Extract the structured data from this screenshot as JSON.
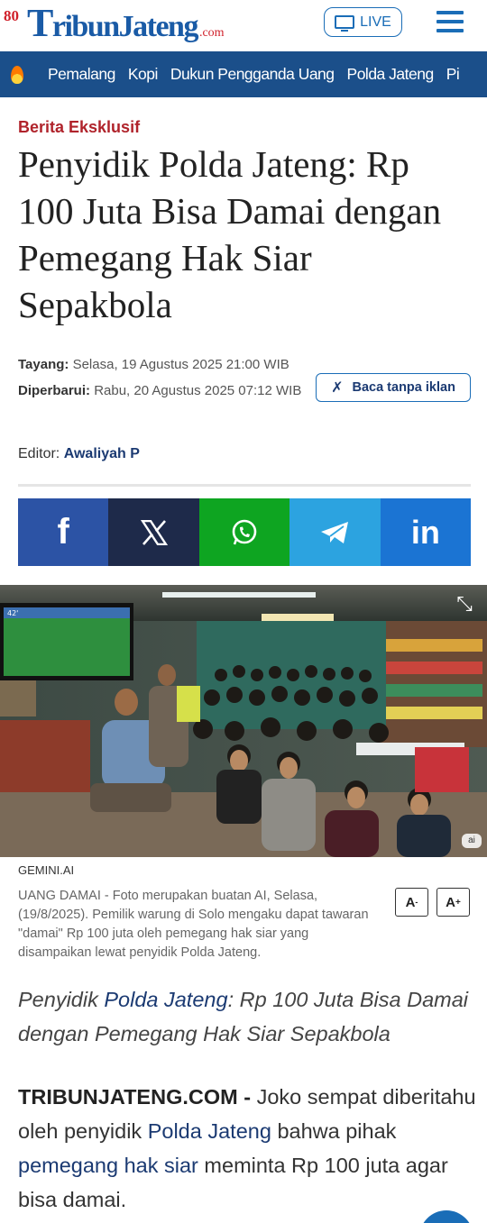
{
  "header": {
    "logo_anniv": "80",
    "logo_text_first": "T",
    "logo_text_rest": "ribunJateng",
    "logo_com": ".com",
    "live_label": "LIVE"
  },
  "nav": {
    "items": [
      {
        "label": "Pemalang"
      },
      {
        "label": "Kopi"
      },
      {
        "label": "Dukun Pengganda Uang"
      },
      {
        "label": "Polda Jateng"
      },
      {
        "label": "Pi"
      }
    ]
  },
  "article": {
    "category": "Berita Eksklusif",
    "title": "Penyidik Polda Jateng: Rp 100 Juta Bisa Damai dengan Pemegang Hak Siar Sepakbola",
    "tayang_label": "Tayang:",
    "tayang_value": "Selasa, 19 Agustus 2025 21:00 WIB",
    "diperbarui_label": "Diperbarui:",
    "diperbarui_value": "Rabu, 20 Agustus 2025 07:12 WIB",
    "adfree_label": "Baca tanpa iklan",
    "editor_label": "Editor:",
    "editor_name": "Awaliyah P"
  },
  "share": {
    "icons": [
      "facebook-icon",
      "x-icon",
      "whatsapp-icon",
      "telegram-icon",
      "linkedin-icon"
    ],
    "colors": [
      "#2c53a5",
      "#1e2a4a",
      "#0ea521",
      "#2ca3e0",
      "#1b74d3"
    ]
  },
  "photo": {
    "scoreboard": "42'",
    "ai_badge": "ai"
  },
  "media": {
    "credit": "GEMINI.AI",
    "caption": "UANG DAMAI - Foto merupakan buatan AI, Selasa, (19/8/2025). Pemilik warung di Solo mengaku dapat tawaran \"damai\" Rp 100 juta oleh pemegang hak siar yang disampaikan lewat penyidik Polda Jateng.",
    "font_minus": "A",
    "font_plus": "A"
  },
  "lead": {
    "part1": "Penyidik ",
    "link": "Polda Jateng",
    "part2": ": Rp 100 Juta Bisa Damai dengan Pemegang Hak Siar Sepakbola"
  },
  "body": {
    "dateline": "TRIBUNJATENG.COM -",
    "t1": " Joko sempat diberitahu oleh penyidik ",
    "link1": "Polda Jateng",
    "t2": " bahwa pihak ",
    "link2": "pemegang hak siar",
    "t3": " meminta Rp 100 juta agar bisa damai."
  },
  "colors": {
    "brand_blue": "#1a6db7",
    "nav_bg": "#1b4f8a",
    "category_red": "#b0232b",
    "link_navy": "#1b3a72"
  }
}
